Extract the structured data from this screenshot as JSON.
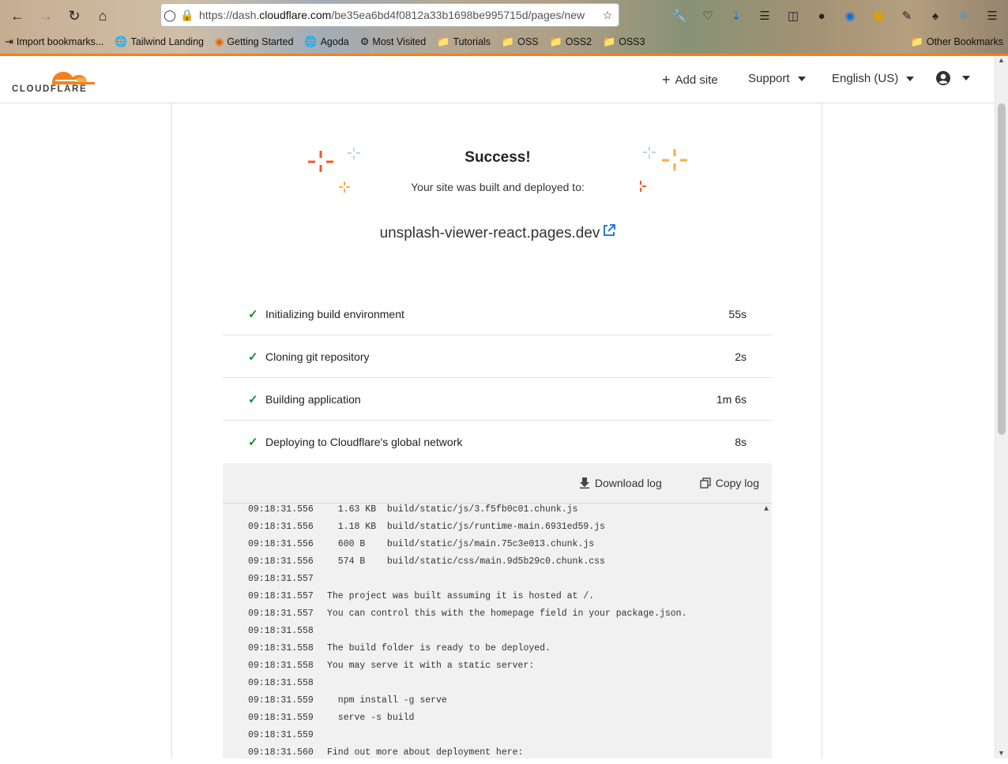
{
  "browser": {
    "url_prefix": "https://dash.",
    "url_domain": "cloudflare.com",
    "url_path": "/be35ea6bd4f0812a33b1698be995715d/pages/new",
    "bookmarks": [
      {
        "label": "Import bookmarks...",
        "icon": "import-icon"
      },
      {
        "label": "Tailwind Landing",
        "icon": "globe-icon"
      },
      {
        "label": "Getting Started",
        "icon": "firefox-icon"
      },
      {
        "label": "Agoda",
        "icon": "globe-icon"
      },
      {
        "label": "Most Visited",
        "icon": "gear-icon"
      },
      {
        "label": "Tutorials",
        "icon": "folder-icon"
      },
      {
        "label": "OSS",
        "icon": "folder-icon"
      },
      {
        "label": "OSS2",
        "icon": "folder-icon"
      },
      {
        "label": "OSS3",
        "icon": "folder-icon"
      }
    ],
    "other_bookmarks": "Other Bookmarks"
  },
  "header": {
    "logo_text": "CLOUDFLARE",
    "add_site": "Add site",
    "support": "Support",
    "language": "English (US)"
  },
  "success": {
    "title": "Success!",
    "subtitle": "Your site was built and deployed to:",
    "site": "unsplash-viewer-react.pages.dev"
  },
  "steps": [
    {
      "label": "Initializing build environment",
      "duration": "55s"
    },
    {
      "label": "Cloning git repository",
      "duration": "2s"
    },
    {
      "label": "Building application",
      "duration": "1m 6s"
    },
    {
      "label": "Deploying to Cloudflare's global network",
      "duration": "8s"
    }
  ],
  "log": {
    "download": "Download log",
    "copy": "Copy log",
    "lines": [
      {
        "ts": "09:18:31.556",
        "msg": "  1.63 KB  build/static/js/3.f5fb0c01.chunk.js"
      },
      {
        "ts": "09:18:31.556",
        "msg": "  1.18 KB  build/static/js/runtime-main.6931ed59.js"
      },
      {
        "ts": "09:18:31.556",
        "msg": "  600 B    build/static/js/main.75c3e013.chunk.js"
      },
      {
        "ts": "09:18:31.556",
        "msg": "  574 B    build/static/css/main.9d5b29c0.chunk.css"
      },
      {
        "ts": "09:18:31.557",
        "msg": ""
      },
      {
        "ts": "09:18:31.557",
        "msg": "The project was built assuming it is hosted at /."
      },
      {
        "ts": "09:18:31.557",
        "msg": "You can control this with the homepage field in your package.json."
      },
      {
        "ts": "09:18:31.558",
        "msg": ""
      },
      {
        "ts": "09:18:31.558",
        "msg": "The build folder is ready to be deployed."
      },
      {
        "ts": "09:18:31.558",
        "msg": "You may serve it with a static server:"
      },
      {
        "ts": "09:18:31.558",
        "msg": ""
      },
      {
        "ts": "09:18:31.559",
        "msg": "  npm install -g serve"
      },
      {
        "ts": "09:18:31.559",
        "msg": "  serve -s build"
      },
      {
        "ts": "09:18:31.559",
        "msg": ""
      },
      {
        "ts": "09:18:31.560",
        "msg": "Find out more about deployment here:"
      }
    ]
  },
  "colors": {
    "accent": "#f38020",
    "success": "#1b8a3a",
    "link": "#0a6dd8"
  }
}
